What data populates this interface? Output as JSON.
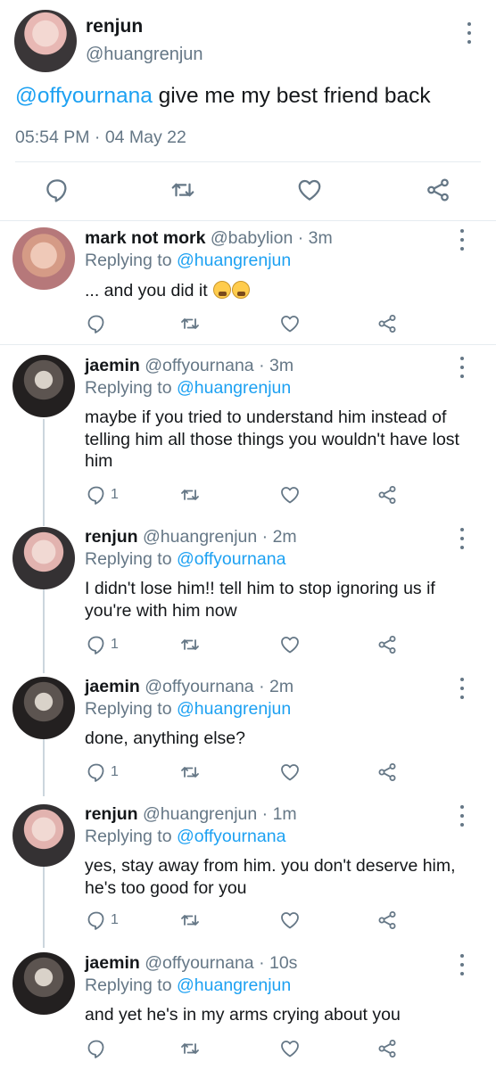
{
  "main_tweet": {
    "name": "renjun",
    "handle": "@huangrenjun",
    "mention": "@offyournana",
    "text": " give me my best friend back",
    "time": "05:54 PM",
    "separator": " · ",
    "date": "04 May 22"
  },
  "replies": [
    {
      "name": "mark not mork",
      "handle": "@babylion",
      "time": "· 3m",
      "replying_label": "Replying to ",
      "replying_to": "@huangrenjun",
      "text": "... and you did it",
      "emoji": [
        "weary-face",
        "weary-face"
      ],
      "reply_count": ""
    },
    {
      "name": "jaemin",
      "handle": "@offyournana",
      "time": "· 3m",
      "replying_label": "Replying to ",
      "replying_to": "@huangrenjun",
      "text": "maybe if you tried to understand him instead of telling him all those things you wouldn't have lost him",
      "reply_count": "1"
    },
    {
      "name": "renjun",
      "handle": "@huangrenjun",
      "time": "· 2m",
      "replying_label": "Replying to ",
      "replying_to": "@offyournana",
      "text": "I didn't lose him!! tell him to stop ignoring us if you're with him now",
      "reply_count": "1"
    },
    {
      "name": "jaemin",
      "handle": "@offyournana",
      "time": "· 2m",
      "replying_label": "Replying to ",
      "replying_to": "@huangrenjun",
      "text": "done, anything else?",
      "reply_count": "1"
    },
    {
      "name": "renjun",
      "handle": "@huangrenjun",
      "time": "· 1m",
      "replying_label": "Replying to ",
      "replying_to": "@offyournana",
      "text": "yes, stay away from him. you don't deserve him, he's too good for you",
      "reply_count": "1"
    },
    {
      "name": "jaemin",
      "handle": "@offyournana",
      "time": "· 10s",
      "replying_label": "Replying to ",
      "replying_to": "@huangrenjun",
      "text": "and yet he's in my arms crying about you",
      "reply_count": ""
    }
  ],
  "icons": {
    "reply": "comment-icon",
    "retweet": "retweet-icon",
    "like": "heart-icon",
    "share": "share-icon",
    "more": "more-vertical-icon"
  },
  "colors": {
    "accent": "#1da1f2",
    "secondary_text": "#657786",
    "divider": "#e6ecf0",
    "thread_line": "#ccd6dd"
  }
}
